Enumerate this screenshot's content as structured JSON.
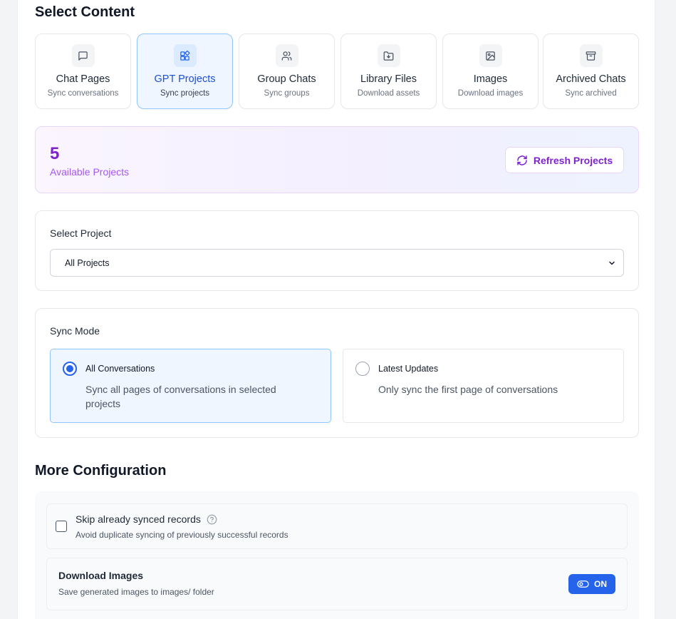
{
  "sections": {
    "select_content": "Select Content",
    "more_configuration": "More Configuration"
  },
  "content_types": [
    {
      "label": "Chat Pages",
      "sub": "Sync conversations",
      "icon": "message-square-icon",
      "active": false
    },
    {
      "label": "GPT Projects",
      "sub": "Sync projects",
      "icon": "shapes-icon",
      "active": true
    },
    {
      "label": "Group Chats",
      "sub": "Sync groups",
      "icon": "users-icon",
      "active": false
    },
    {
      "label": "Library Files",
      "sub": "Download assets",
      "icon": "folder-download-icon",
      "active": false
    },
    {
      "label": "Images",
      "sub": "Download images",
      "icon": "image-icon",
      "active": false
    },
    {
      "label": "Archived Chats",
      "sub": "Sync archived",
      "icon": "archive-icon",
      "active": false
    }
  ],
  "stats": {
    "count": "5",
    "label": "Available Projects",
    "refresh_button": "Refresh Projects"
  },
  "project_select": {
    "label": "Select Project",
    "value": "All Projects"
  },
  "sync_mode": {
    "label": "Sync Mode",
    "options": [
      {
        "title": "All Conversations",
        "desc": "Sync all pages of conversations in selected projects",
        "selected": true
      },
      {
        "title": "Latest Updates",
        "desc": "Only sync the first page of conversations",
        "selected": false
      }
    ]
  },
  "config": {
    "skip": {
      "title": "Skip already synced records",
      "desc": "Avoid duplicate syncing of previously successful records",
      "checked": false
    },
    "download_images": {
      "title": "Download Images",
      "desc": "Save generated images to images/ folder",
      "toggle_label": "ON",
      "enabled": true
    }
  },
  "colors": {
    "accent_blue": "#2563eb",
    "accent_purple": "#7e22ce"
  }
}
